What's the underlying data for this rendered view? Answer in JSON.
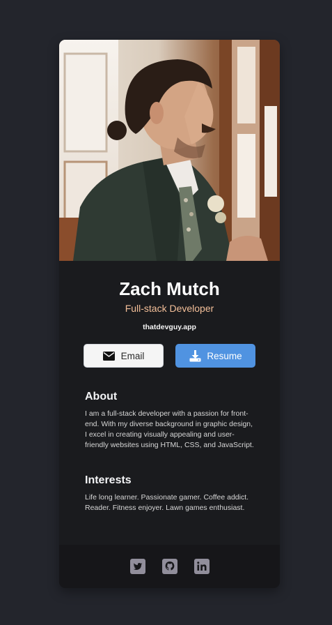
{
  "profile": {
    "name": "Zach Mutch",
    "role": "Full-stack Developer",
    "website": "thatdevguy.app"
  },
  "buttons": {
    "email_label": "Email",
    "email_icon": "envelope-icon",
    "resume_label": "Resume",
    "resume_icon": "download-icon"
  },
  "about": {
    "title": "About",
    "text": "I am a full-stack developer with a passion for front-end. With my diverse background in graphic design, I excel in creating visually appealing and user-friendly websites using HTML, CSS, and JavaScript."
  },
  "interests": {
    "title": "Interests",
    "text": "Life long learner. Passionate gamer. Coffee addict. Reader. Fitness enjoyer. Lawn games enthusiast."
  },
  "footer": {
    "icons": [
      "twitter-icon",
      "github-icon",
      "linkedin-icon"
    ]
  },
  "colors": {
    "page_background": "#23252c",
    "card_background": "#1a1b1e",
    "footer_background": "#161619",
    "accent_role": "#f3bf99",
    "resume_button": "#5093e1",
    "email_button": "#f5f5f5",
    "social_icon": "#918e9b"
  }
}
